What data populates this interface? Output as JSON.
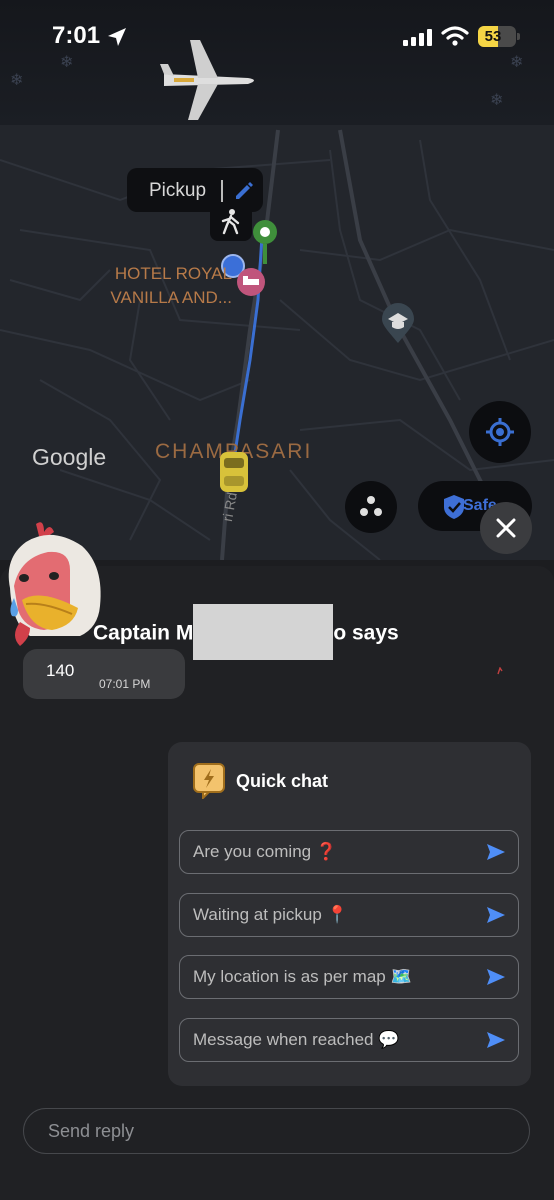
{
  "status_bar": {
    "time": "7:01",
    "battery": "53",
    "icons": [
      "location-arrow-icon",
      "cellular-signal-icon",
      "wifi-icon",
      "battery-icon"
    ]
  },
  "map": {
    "pickup_label": "Pickup",
    "hotel_label": "HOTEL ROYAL VANILLA AND...",
    "place_label": "CHAMPASARI",
    "google_logo": "Google",
    "road_label": "ri Rd",
    "safety_label": "Safe",
    "colors": {
      "route": "#3a6fd2",
      "map_bg": "#23262c",
      "pickup_pin": "#3f8f3b",
      "hotel_pin": "#c0557c"
    }
  },
  "chat": {
    "header": {
      "prefix": "Captain M",
      "suffix": "o says"
    },
    "messages": [
      {
        "text": "140",
        "time": "07:01 PM"
      }
    ],
    "quick_chat": {
      "title": "Quick chat",
      "replies": [
        "Are you coming ❓",
        "Waiting at pickup 📍",
        "My location is as per map 🗺️",
        "Message when reached 💬"
      ]
    },
    "reply_placeholder": "Send reply",
    "accent": "#4f8ef7"
  }
}
